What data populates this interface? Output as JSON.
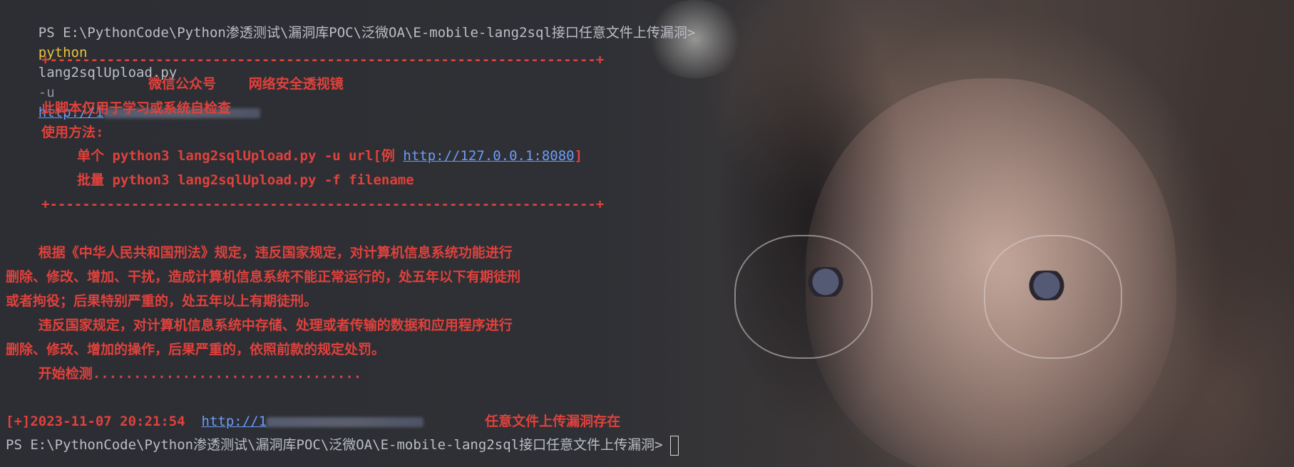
{
  "terminal": {
    "prompt": "PS E:\\PythonCode\\Python渗透测试\\漏洞库POC\\泛微OA\\E-mobile-lang2sql接口任意文件上传漏洞>",
    "command": {
      "program": "python",
      "script": "lang2sqlUpload.py",
      "flag": "-u",
      "url": "http://1"
    },
    "banner": {
      "border_top": "+-------------------------------------------------------------------+",
      "title": "微信公众号    网络安全透视镜",
      "disclaimer": "此脚本仅用于学习或系统自检查",
      "usage_label": "使用方法:",
      "usage_single_prefix": "单个 python3 lang2sqlUpload.py -u url[例 ",
      "usage_single_example_url": "http://127.0.0.1:8080",
      "usage_single_suffix": "]",
      "usage_batch": "批量 python3 lang2sqlUpload.py -f filename",
      "border_bottom": "+-------------------------------------------------------------------+"
    },
    "legal": [
      "    根据《中华人民共和国刑法》规定，违反国家规定，对计算机信息系统功能进行",
      "删除、修改、增加、干扰，造成计算机信息系统不能正常运行的，处五年以下有期徒刑",
      "或者拘役；后果特别严重的，处五年以上有期徒刑。",
      "    违反国家规定，对计算机信息系统中存储、处理或者传输的数据和应用程序进行",
      "删除、修改、增加的操作，后果严重的，依照前款的规定处罚。"
    ],
    "progress": "    开始检测.................................",
    "result": {
      "prefix": "[+]2023-11-07 20:21:54  ",
      "url": "http://1",
      "message": "任意文件上传漏洞存在"
    },
    "final_prompt": "PS E:\\PythonCode\\Python渗透测试\\漏洞库POC\\泛微OA\\E-mobile-lang2sql接口任意文件上传漏洞>"
  },
  "colors": {
    "prompt": "#bbbfc6",
    "command": "#e9c23e",
    "link": "#6d9cf6",
    "banner": "#e0413c"
  }
}
